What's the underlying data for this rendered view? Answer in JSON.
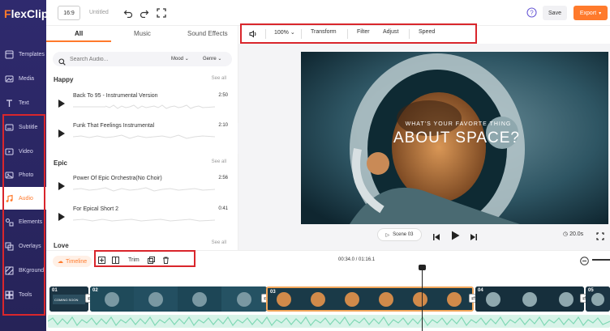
{
  "app": {
    "logo_prefix": "F",
    "logo_rest": "lexClip"
  },
  "topbar": {
    "ratio": "16:9",
    "doc_title": "Untitled",
    "save_label": "Save",
    "export_label": "Export"
  },
  "sidebar": {
    "items": [
      {
        "label": "Templates",
        "icon": "templates-icon"
      },
      {
        "label": "Media",
        "icon": "media-icon"
      },
      {
        "label": "Text",
        "icon": "text-icon"
      },
      {
        "label": "Subtitle",
        "icon": "subtitle-icon"
      },
      {
        "label": "Video",
        "icon": "video-icon"
      },
      {
        "label": "Photo",
        "icon": "photo-icon"
      },
      {
        "label": "Audio",
        "icon": "audio-icon"
      },
      {
        "label": "Elements",
        "icon": "elements-icon"
      },
      {
        "label": "Overlays",
        "icon": "overlays-icon"
      },
      {
        "label": "BKground",
        "icon": "background-icon"
      },
      {
        "label": "Tools",
        "icon": "tools-icon"
      }
    ],
    "active": "Audio"
  },
  "panel": {
    "tabs": [
      "All",
      "Music",
      "Sound Effects"
    ],
    "active_tab": "All",
    "search_placeholder": "Search Audio...",
    "mood_label": "Mood",
    "genre_label": "Genre",
    "see_all": "See all",
    "categories": [
      {
        "name": "Happy",
        "tracks": [
          {
            "name": "Back To 95 - Instrumental Version",
            "duration": "2:50"
          },
          {
            "name": "Funk That Feelings Instrumental",
            "duration": "2:10"
          }
        ]
      },
      {
        "name": "Epic",
        "tracks": [
          {
            "name": "Power Of Epic Orchestra(No Choir)",
            "duration": "2:56"
          },
          {
            "name": "For Epical Short 2",
            "duration": "0:41"
          }
        ]
      },
      {
        "name": "Love",
        "tracks": []
      }
    ]
  },
  "toolbar": {
    "volume_icon": "volume-icon",
    "zoom": "100%",
    "transform": "Transform",
    "filter": "Filter",
    "adjust": "Adjust",
    "speed": "Speed"
  },
  "preview": {
    "question": "WHAT'S YOUR FAVORTE THING",
    "headline": "ABOUT SPACE?"
  },
  "player": {
    "scene": "Scene 03",
    "duration": "20.0s"
  },
  "timeline": {
    "label": "Timeline",
    "trim": "Trim",
    "timecode": "00:34.0 / 01:16.1",
    "clips": [
      {
        "num": "01",
        "text": "COMING SOON"
      },
      {
        "num": "02",
        "text": ""
      },
      {
        "num": "03",
        "text": ""
      },
      {
        "num": "04",
        "text": ""
      },
      {
        "num": "05",
        "text": ""
      }
    ],
    "selected_clip": "03"
  },
  "colors": {
    "accent": "#ff7a2c",
    "sidebar": "#2f2a6e",
    "highlight_box": "#d9262c",
    "audio_track": "#7fd8b4"
  }
}
